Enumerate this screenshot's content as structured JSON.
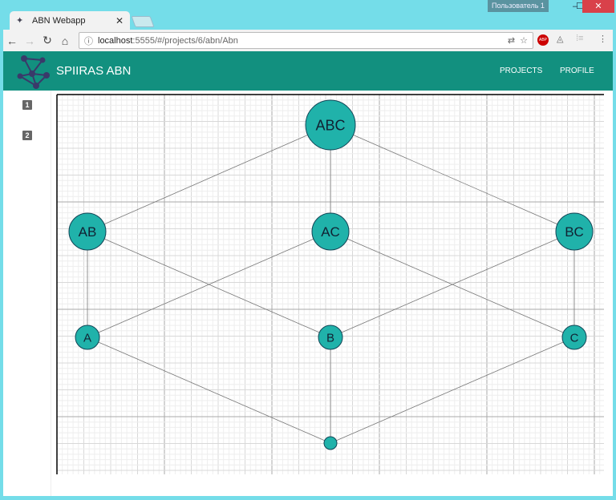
{
  "browser": {
    "tab_title": "ABN Webapp",
    "url_host": "localhost",
    "url_rest": ":5555/#/projects/6/abn/Abn",
    "user_badge": "Пользователь 1",
    "ext_abp": "ABP"
  },
  "app": {
    "title": "SPIIRAS ABN",
    "nav": [
      "PROJECTS",
      "PROFILE"
    ]
  },
  "sidebar": {
    "items": [
      "1",
      "2"
    ]
  },
  "graph": {
    "node_color": "#20b2aa",
    "nodes": [
      {
        "id": "ABC",
        "label": "ABC",
        "level": 0,
        "pos": 1
      },
      {
        "id": "AB",
        "label": "AB",
        "level": 1,
        "pos": 0
      },
      {
        "id": "AC",
        "label": "AC",
        "level": 1,
        "pos": 1
      },
      {
        "id": "BC",
        "label": "BC",
        "level": 1,
        "pos": 2
      },
      {
        "id": "A",
        "label": "A",
        "level": 2,
        "pos": 0
      },
      {
        "id": "B",
        "label": "B",
        "level": 2,
        "pos": 1
      },
      {
        "id": "C",
        "label": "C",
        "level": 2,
        "pos": 2
      },
      {
        "id": "empty",
        "label": "",
        "level": 3,
        "pos": 1
      }
    ],
    "edges": [
      [
        "ABC",
        "AB"
      ],
      [
        "ABC",
        "AC"
      ],
      [
        "ABC",
        "BC"
      ],
      [
        "AB",
        "A"
      ],
      [
        "AB",
        "B"
      ],
      [
        "AC",
        "A"
      ],
      [
        "AC",
        "C"
      ],
      [
        "BC",
        "B"
      ],
      [
        "BC",
        "C"
      ],
      [
        "A",
        "empty"
      ],
      [
        "B",
        "empty"
      ],
      [
        "C",
        "empty"
      ]
    ]
  }
}
